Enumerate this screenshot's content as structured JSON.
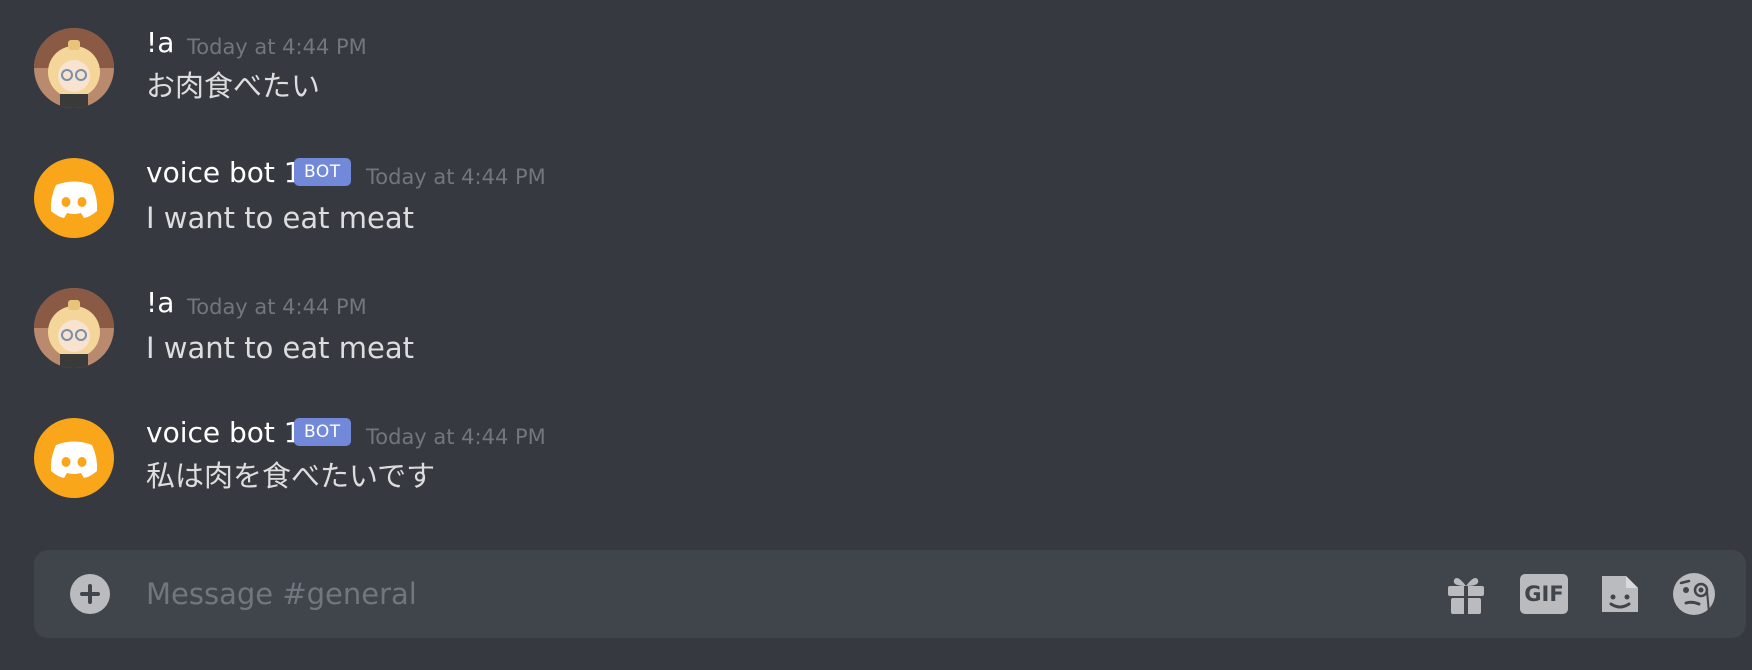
{
  "messages": [
    {
      "author": "!a",
      "is_bot": false,
      "time": "Today at 4:44 PM",
      "text": "お肉食べたい"
    },
    {
      "author": "voice bot 1",
      "is_bot": true,
      "bot_tag": "BOT",
      "time": "Today at 4:44 PM",
      "text": "I want to eat meat"
    },
    {
      "author": "!a",
      "is_bot": false,
      "time": "Today at 4:44 PM",
      "text": "I want to eat meat"
    },
    {
      "author": "voice bot 1",
      "is_bot": true,
      "bot_tag": "BOT",
      "time": "Today at 4:44 PM",
      "text": "私は肉を食べたいです"
    }
  ],
  "composer": {
    "placeholder": "Message #general",
    "add_icon": "plus-circle-icon",
    "gift_icon": "gift-icon",
    "gif_label": "GIF",
    "sticker_icon": "sticker-icon",
    "emoji_icon": "emoji-face-icon"
  },
  "colors": {
    "background": "#36393f",
    "composer_bg": "#40444b",
    "bot_tag": "#7289da",
    "bot_avatar": "#faa61a",
    "timestamp": "#72767d",
    "message_text": "#dcddde"
  }
}
